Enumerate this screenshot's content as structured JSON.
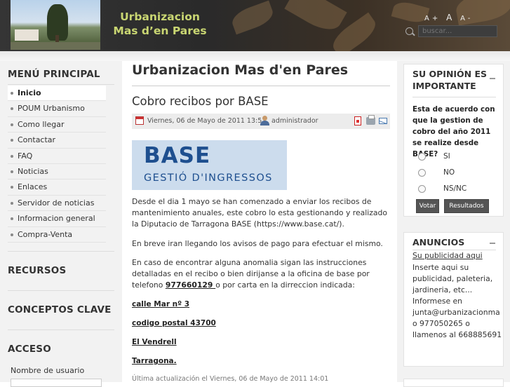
{
  "header": {
    "site_title_line1": "Urbanizacion",
    "site_title_line2": "Mas d’en Pares",
    "font_tools": [
      "A+",
      "A",
      "A-"
    ],
    "search_placeholder": "buscar..."
  },
  "sidebar_left": {
    "menu_heading": "MENÚ PRINCIPAL",
    "menu_items": [
      {
        "label": "Inicio",
        "active": true
      },
      {
        "label": "POUM Urbanismo"
      },
      {
        "label": "Como llegar"
      },
      {
        "label": "Contactar"
      },
      {
        "label": "FAQ"
      },
      {
        "label": "Noticias"
      },
      {
        "label": "Enlaces"
      },
      {
        "label": "Servidor de noticias"
      },
      {
        "label": "Informacion general"
      },
      {
        "label": "Compra-Venta"
      }
    ],
    "resources_heading": "RECURSOS",
    "concepts_heading": "CONCEPTOS CLAVE",
    "access_heading": "ACCESO",
    "username_label": "Nombre de usuario"
  },
  "main": {
    "page_title": "Urbanizacion Mas d'en Pares",
    "article_title": "Cobro recibos por BASE",
    "meta_date": "Viernes, 06 de Mayo de 2011 13:53",
    "meta_author": "administrador",
    "logo_word": "BASE",
    "logo_sub": "GESTIÓ  D'INGRESSOS",
    "para1": "Desde el dia 1 mayo se han comenzado a enviar los recibos de mantenimiento anuales, este cobro lo esta gestionando y realizado la Diputacio de Tarragona BASE (https://www.base.cat/).",
    "para2": "En breve iran llegando los avisos de pago para efectuar el mismo.",
    "para3_a": "En caso de encontrar alguna anomalia sigan las instrucciones detalladas en el recibo o bien dirijanse a la oficina de base por telefono ",
    "para3_phone": "977660129 ",
    "para3_b": "o por carta en la dirreccion indicada:",
    "address": [
      "calle Mar nº 3",
      "codigo postal 43700",
      "El Vendrell",
      "Tarragona."
    ],
    "last_update": "Última actualización el Viernes, 06 de Mayo de 2011 14:01"
  },
  "sidebar_right": {
    "poll_heading_line1": "SU OPINIÓN ES",
    "poll_heading_line2": "IMPORTANTE",
    "poll_question": "Esta de acuerdo con que la gestion de cobro del año 2011 se realize desde BASE?",
    "poll_options": [
      "SI",
      "NO",
      "NS/NC"
    ],
    "vote_label": "Votar",
    "results_label": "Resultados",
    "ads_heading": "ANUNCIOS",
    "ads_link": "Su publicidad aqui",
    "ads_body": "Inserte aqui su publicidad, paleteria, jardineria, etc...\nInformese en junta@urbanizacionma o 977050265 o llamenos al 668885691"
  }
}
